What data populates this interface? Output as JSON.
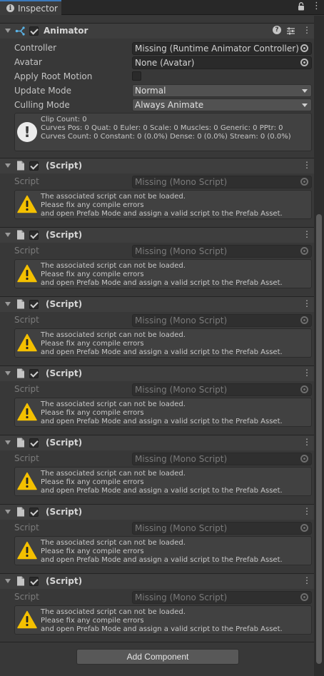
{
  "tab": {
    "title": "Inspector"
  },
  "animator": {
    "title": "Animator",
    "controller_label": "Controller",
    "controller_value": "Missing (Runtime Animator Controller)",
    "avatar_label": "Avatar",
    "avatar_value": "None (Avatar)",
    "apply_root_motion_label": "Apply Root Motion",
    "update_mode_label": "Update Mode",
    "update_mode_value": "Normal",
    "culling_mode_label": "Culling Mode",
    "culling_mode_value": "Always Animate",
    "info_lines": [
      "Clip Count: 0",
      "Curves Pos: 0 Quat: 0 Euler: 0 Scale: 0 Muscles: 0 Generic: 0 PPtr: 0",
      "Curves Count: 0 Constant: 0 (0.0%) Dense: 0 (0.0%) Stream: 0 (0.0%)"
    ]
  },
  "scripts": [
    {
      "title": "(Script)",
      "field_label": "Script",
      "field_value": "Missing (Mono Script)",
      "warning_lines": [
        "The associated script can not be loaded.",
        "Please fix any compile errors",
        "and open Prefab Mode and assign a valid script to the Prefab Asset."
      ]
    },
    {
      "title": "(Script)",
      "field_label": "Script",
      "field_value": "Missing (Mono Script)",
      "warning_lines": [
        "The associated script can not be loaded.",
        "Please fix any compile errors",
        "and open Prefab Mode and assign a valid script to the Prefab Asset."
      ]
    },
    {
      "title": "(Script)",
      "field_label": "Script",
      "field_value": "Missing (Mono Script)",
      "warning_lines": [
        "The associated script can not be loaded.",
        "Please fix any compile errors",
        "and open Prefab Mode and assign a valid script to the Prefab Asset."
      ]
    },
    {
      "title": "(Script)",
      "field_label": "Script",
      "field_value": "Missing (Mono Script)",
      "warning_lines": [
        "The associated script can not be loaded.",
        "Please fix any compile errors",
        "and open Prefab Mode and assign a valid script to the Prefab Asset."
      ]
    },
    {
      "title": "(Script)",
      "field_label": "Script",
      "field_value": "Missing (Mono Script)",
      "warning_lines": [
        "The associated script can not be loaded.",
        "Please fix any compile errors",
        "and open Prefab Mode and assign a valid script to the Prefab Asset."
      ]
    },
    {
      "title": "(Script)",
      "field_label": "Script",
      "field_value": "Missing (Mono Script)",
      "warning_lines": [
        "The associated script can not be loaded.",
        "Please fix any compile errors",
        "and open Prefab Mode and assign a valid script to the Prefab Asset."
      ]
    },
    {
      "title": "(Script)",
      "field_label": "Script",
      "field_value": "Missing (Mono Script)",
      "warning_lines": [
        "The associated script can not be loaded.",
        "Please fix any compile errors",
        "and open Prefab Mode and assign a valid script to the Prefab Asset."
      ]
    }
  ],
  "add_component_label": "Add Component"
}
